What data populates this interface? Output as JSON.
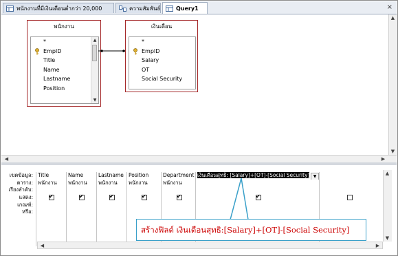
{
  "tabs": [
    {
      "label": "พนักงานที่มีเงินเดือนต่ำกว่า 20,000",
      "active": false
    },
    {
      "label": "ความสัมพันธ์",
      "active": false
    },
    {
      "label": "Query1",
      "active": true
    }
  ],
  "close_label": "×",
  "tables": [
    {
      "title": "พนักงาน",
      "fields": [
        "*",
        "EmpID",
        "Title",
        "Name",
        "Lastname",
        "Position"
      ],
      "key_field": "EmpID"
    },
    {
      "title": "เงินเดือน",
      "fields": [
        "*",
        "EmpID",
        "Salary",
        "OT",
        "Social Security"
      ],
      "key_field": "EmpID"
    }
  ],
  "grid": {
    "row_labels": [
      "เขตข้อมูล:",
      "ตาราง:",
      "เรียงลำดับ:",
      "แสดง:",
      "เกณฑ์:",
      "หรือ:"
    ],
    "columns": [
      {
        "field": "Title",
        "table": "พนักงาน",
        "show": true
      },
      {
        "field": "Name",
        "table": "พนักงาน",
        "show": true
      },
      {
        "field": "Lastname",
        "table": "พนักงาน",
        "show": true
      },
      {
        "field": "Position",
        "table": "พนักงาน",
        "show": true
      },
      {
        "field": "Department",
        "table": "พนักงาน",
        "show": true
      },
      {
        "field": "เงินเดือนสุทธิ: [Salary]+[OT]-[Social Security]",
        "table": "",
        "show": true
      },
      {
        "field": "",
        "table": "",
        "show": false
      }
    ]
  },
  "callout_text": "สร้างฟิลด์ เงินเดือนสุทธิ:[Salary]+[OT]-[Social Security]",
  "colors": {
    "table_border": "#a5292a",
    "callout_border": "#3aa0c9",
    "callout_text": "#cc0000"
  }
}
